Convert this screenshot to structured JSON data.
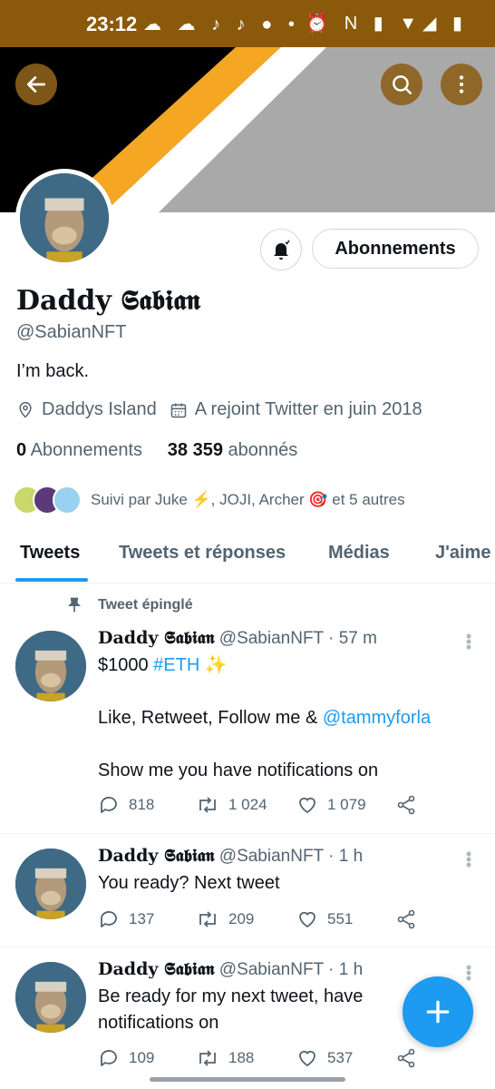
{
  "status_bar": {
    "time": "23:12",
    "left_icons": "☁ ☁ ♪ ♪ ● •",
    "right_icons": "⏰ N ▮ ▼◢ ▮"
  },
  "header": {
    "back_icon": "arrow-left",
    "search_icon": "search",
    "more_icon": "more-vertical",
    "banner_colors": [
      "#000000",
      "#f5a623",
      "#ffffff",
      "#a9a9a9"
    ]
  },
  "profile": {
    "display_name": "Daddy 𝕾𝖆𝖇𝖎𝖆𝖓",
    "handle": "@SabianNFT",
    "bio": "I’m back.",
    "location": "Daddys Island",
    "joined": "A rejoint Twitter en juin 2018",
    "following_count": "0",
    "following_label": "Abonnements",
    "followers_count": "38 359",
    "followers_label": "abonnés",
    "followed_by": "Suivi par Juke ⚡, JOJI, Archer 🎯 et 5 autres",
    "follow_button": "Abonnements"
  },
  "tabs": [
    {
      "label": "Tweets",
      "active": true
    },
    {
      "label": "Tweets et réponses",
      "active": false
    },
    {
      "label": "Médias",
      "active": false
    },
    {
      "label": "J'aime",
      "active": false
    }
  ],
  "pinned_label": "Tweet épinglé",
  "tweets": [
    {
      "name": "Daddy 𝕾𝖆𝖇𝖎𝖆𝖓",
      "handle": "@SabianNFT",
      "time": "57 m",
      "text_a": "$1000 ",
      "hashtag": "#ETH",
      "text_b": " ✨",
      "line2_a": "Like, Retweet, Follow me & ",
      "mention": "@tammyforla",
      "line3": "Show me you have notifications on",
      "replies": "818",
      "retweets": "1 024",
      "likes": "1 079"
    },
    {
      "name": "Daddy 𝕾𝖆𝖇𝖎𝖆𝖓",
      "handle": "@SabianNFT",
      "time": "1 h",
      "text": "You ready? Next tweet",
      "replies": "137",
      "retweets": "209",
      "likes": "551"
    },
    {
      "name": "Daddy 𝕾𝖆𝖇𝖎𝖆𝖓",
      "handle": "@SabianNFT",
      "time": "1 h",
      "text": "Be ready for my next tweet, have notifications on",
      "replies": "109",
      "retweets": "188",
      "likes": "537"
    }
  ],
  "colors": {
    "accent": "#1d9bf0",
    "muted": "#536471",
    "status_bar": "#8a5a0a"
  }
}
